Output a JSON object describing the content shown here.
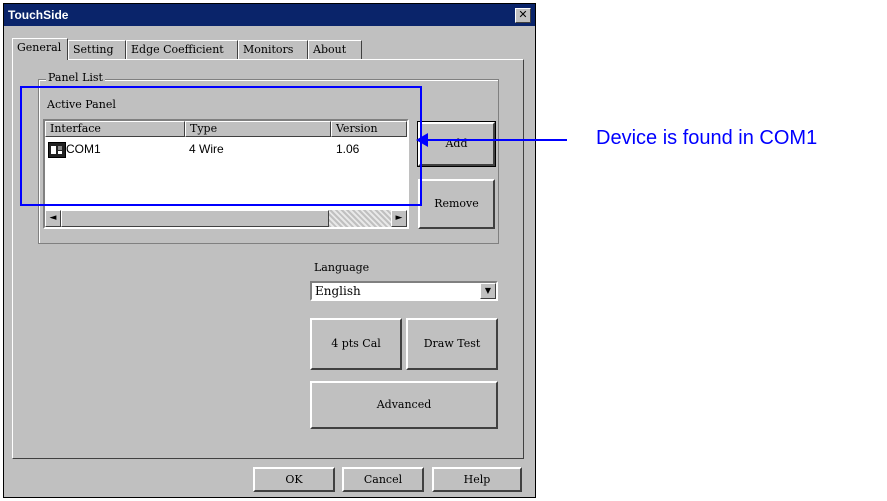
{
  "window": {
    "title": "TouchSide",
    "close_glyph": "✕"
  },
  "tabs": [
    "General",
    "Setting",
    "Edge Coefficient",
    "Monitors",
    "About"
  ],
  "panel_list": {
    "group_label": "Panel List",
    "active_label": "Active Panel",
    "columns": [
      "Interface",
      "Type",
      "Version"
    ],
    "rows": [
      {
        "interface": "COM1",
        "type": "4 Wire",
        "version": "1.06",
        "icon": "serial-port-icon"
      }
    ]
  },
  "buttons": {
    "add": "Add",
    "remove": "Remove",
    "cal": "4 pts Cal",
    "draw_test": "Draw Test",
    "advanced": "Advanced",
    "ok": "OK",
    "cancel": "Cancel",
    "help": "Help"
  },
  "language": {
    "label": "Language",
    "value": "English"
  },
  "annotation": {
    "text": "Device is found in COM1",
    "color": "#0000ff"
  },
  "scroll": {
    "left_arrow": "◄",
    "right_arrow": "►",
    "combo_arrow": "▼"
  }
}
